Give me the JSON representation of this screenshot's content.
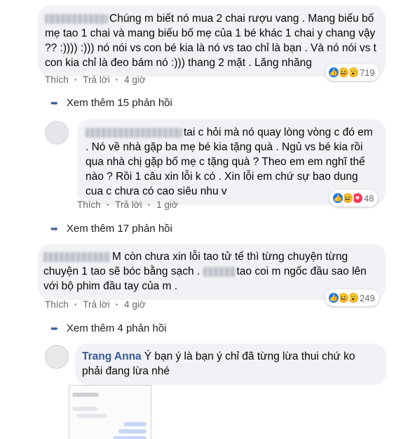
{
  "comments": [
    {
      "text": "Chúng m biết nó mua 2 chai rượu vang . Mang biếu bố mẹ tao 1 chai và mang biếu bố mẹ của 1 bé khác 1 chai y chang vậy ?? :)))) :))) nó nói vs con bé kia là nó vs tao chỉ là bạn . Và nó nói vs t con kia chỉ là đeo bám nó :))) thang 2 mặt . Lăng nhăng",
      "like": "Thích",
      "reply": "Trả lời",
      "time": "4 giờ",
      "reaction_count": "719",
      "reactions": [
        "like-icon",
        "haha-icon",
        "wow-icon"
      ],
      "more_replies": "Xem thêm 15 phản hồi"
    },
    {
      "text": "tai c hỏi mà nó quay lòng vòng c đó em . Nó về nhà gặp ba mẹ bé kia tặng quà . Ngủ vs bé kia rồi qua nhà chị gặp bố mẹ c tặng quà ? Theo em em nghĩ thế nào ? Rồi 1 câu xin lỗi k có . Xin lỗi em chứ sự bao dung cua c chưa có cao siêu nhu v",
      "like": "Thích",
      "reply": "Trả lời",
      "time": "1 giờ",
      "reaction_count": "48",
      "reactions": [
        "like-icon",
        "haha-icon",
        "love-icon"
      ],
      "more_replies": "Xem thêm 17 phản hồi"
    },
    {
      "text_a": "M còn chưa xin lỗi tao tử tế thì từng chuyện từng chuyện 1 tao sẽ bóc bằng sạch .",
      "text_b": "tao coi m ngốc đầu sao lên với bộ phim đầu tay của m .",
      "like": "Thích",
      "reply": "Trả lời",
      "time": "4 giờ",
      "reaction_count": "249",
      "reactions": [
        "like-icon",
        "haha-icon",
        "wow-icon"
      ],
      "more_replies": "Xem thêm 4 phản hồi"
    }
  ],
  "reply": {
    "name": "Trang Anna",
    "text": "Ý bạn ý là bạn ý chỉ đã từng lừa thui chứ ko phải đang lừa nhé"
  },
  "colors": {
    "link": "#385898",
    "bubble": "#f0f2f5",
    "meta": "#65676b"
  }
}
